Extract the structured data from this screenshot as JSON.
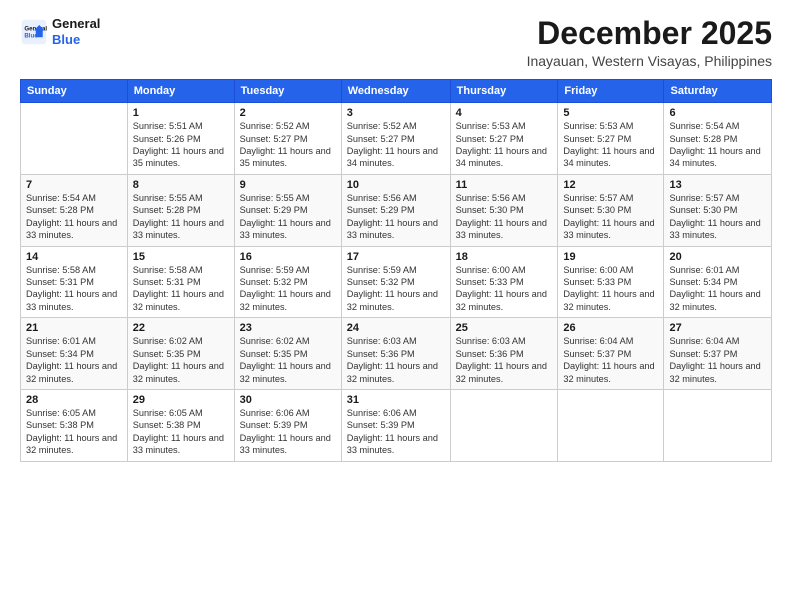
{
  "logo": {
    "line1": "General",
    "line2": "Blue"
  },
  "header": {
    "title": "December 2025",
    "subtitle": "Inayauan, Western Visayas, Philippines"
  },
  "weekdays": [
    "Sunday",
    "Monday",
    "Tuesday",
    "Wednesday",
    "Thursday",
    "Friday",
    "Saturday"
  ],
  "weeks": [
    [
      {
        "day": "",
        "sunrise": "",
        "sunset": "",
        "daylight": ""
      },
      {
        "day": "1",
        "sunrise": "Sunrise: 5:51 AM",
        "sunset": "Sunset: 5:26 PM",
        "daylight": "Daylight: 11 hours and 35 minutes."
      },
      {
        "day": "2",
        "sunrise": "Sunrise: 5:52 AM",
        "sunset": "Sunset: 5:27 PM",
        "daylight": "Daylight: 11 hours and 35 minutes."
      },
      {
        "day": "3",
        "sunrise": "Sunrise: 5:52 AM",
        "sunset": "Sunset: 5:27 PM",
        "daylight": "Daylight: 11 hours and 34 minutes."
      },
      {
        "day": "4",
        "sunrise": "Sunrise: 5:53 AM",
        "sunset": "Sunset: 5:27 PM",
        "daylight": "Daylight: 11 hours and 34 minutes."
      },
      {
        "day": "5",
        "sunrise": "Sunrise: 5:53 AM",
        "sunset": "Sunset: 5:27 PM",
        "daylight": "Daylight: 11 hours and 34 minutes."
      },
      {
        "day": "6",
        "sunrise": "Sunrise: 5:54 AM",
        "sunset": "Sunset: 5:28 PM",
        "daylight": "Daylight: 11 hours and 34 minutes."
      }
    ],
    [
      {
        "day": "7",
        "sunrise": "Sunrise: 5:54 AM",
        "sunset": "Sunset: 5:28 PM",
        "daylight": "Daylight: 11 hours and 33 minutes."
      },
      {
        "day": "8",
        "sunrise": "Sunrise: 5:55 AM",
        "sunset": "Sunset: 5:28 PM",
        "daylight": "Daylight: 11 hours and 33 minutes."
      },
      {
        "day": "9",
        "sunrise": "Sunrise: 5:55 AM",
        "sunset": "Sunset: 5:29 PM",
        "daylight": "Daylight: 11 hours and 33 minutes."
      },
      {
        "day": "10",
        "sunrise": "Sunrise: 5:56 AM",
        "sunset": "Sunset: 5:29 PM",
        "daylight": "Daylight: 11 hours and 33 minutes."
      },
      {
        "day": "11",
        "sunrise": "Sunrise: 5:56 AM",
        "sunset": "Sunset: 5:30 PM",
        "daylight": "Daylight: 11 hours and 33 minutes."
      },
      {
        "day": "12",
        "sunrise": "Sunrise: 5:57 AM",
        "sunset": "Sunset: 5:30 PM",
        "daylight": "Daylight: 11 hours and 33 minutes."
      },
      {
        "day": "13",
        "sunrise": "Sunrise: 5:57 AM",
        "sunset": "Sunset: 5:30 PM",
        "daylight": "Daylight: 11 hours and 33 minutes."
      }
    ],
    [
      {
        "day": "14",
        "sunrise": "Sunrise: 5:58 AM",
        "sunset": "Sunset: 5:31 PM",
        "daylight": "Daylight: 11 hours and 33 minutes."
      },
      {
        "day": "15",
        "sunrise": "Sunrise: 5:58 AM",
        "sunset": "Sunset: 5:31 PM",
        "daylight": "Daylight: 11 hours and 32 minutes."
      },
      {
        "day": "16",
        "sunrise": "Sunrise: 5:59 AM",
        "sunset": "Sunset: 5:32 PM",
        "daylight": "Daylight: 11 hours and 32 minutes."
      },
      {
        "day": "17",
        "sunrise": "Sunrise: 5:59 AM",
        "sunset": "Sunset: 5:32 PM",
        "daylight": "Daylight: 11 hours and 32 minutes."
      },
      {
        "day": "18",
        "sunrise": "Sunrise: 6:00 AM",
        "sunset": "Sunset: 5:33 PM",
        "daylight": "Daylight: 11 hours and 32 minutes."
      },
      {
        "day": "19",
        "sunrise": "Sunrise: 6:00 AM",
        "sunset": "Sunset: 5:33 PM",
        "daylight": "Daylight: 11 hours and 32 minutes."
      },
      {
        "day": "20",
        "sunrise": "Sunrise: 6:01 AM",
        "sunset": "Sunset: 5:34 PM",
        "daylight": "Daylight: 11 hours and 32 minutes."
      }
    ],
    [
      {
        "day": "21",
        "sunrise": "Sunrise: 6:01 AM",
        "sunset": "Sunset: 5:34 PM",
        "daylight": "Daylight: 11 hours and 32 minutes."
      },
      {
        "day": "22",
        "sunrise": "Sunrise: 6:02 AM",
        "sunset": "Sunset: 5:35 PM",
        "daylight": "Daylight: 11 hours and 32 minutes."
      },
      {
        "day": "23",
        "sunrise": "Sunrise: 6:02 AM",
        "sunset": "Sunset: 5:35 PM",
        "daylight": "Daylight: 11 hours and 32 minutes."
      },
      {
        "day": "24",
        "sunrise": "Sunrise: 6:03 AM",
        "sunset": "Sunset: 5:36 PM",
        "daylight": "Daylight: 11 hours and 32 minutes."
      },
      {
        "day": "25",
        "sunrise": "Sunrise: 6:03 AM",
        "sunset": "Sunset: 5:36 PM",
        "daylight": "Daylight: 11 hours and 32 minutes."
      },
      {
        "day": "26",
        "sunrise": "Sunrise: 6:04 AM",
        "sunset": "Sunset: 5:37 PM",
        "daylight": "Daylight: 11 hours and 32 minutes."
      },
      {
        "day": "27",
        "sunrise": "Sunrise: 6:04 AM",
        "sunset": "Sunset: 5:37 PM",
        "daylight": "Daylight: 11 hours and 32 minutes."
      }
    ],
    [
      {
        "day": "28",
        "sunrise": "Sunrise: 6:05 AM",
        "sunset": "Sunset: 5:38 PM",
        "daylight": "Daylight: 11 hours and 32 minutes."
      },
      {
        "day": "29",
        "sunrise": "Sunrise: 6:05 AM",
        "sunset": "Sunset: 5:38 PM",
        "daylight": "Daylight: 11 hours and 33 minutes."
      },
      {
        "day": "30",
        "sunrise": "Sunrise: 6:06 AM",
        "sunset": "Sunset: 5:39 PM",
        "daylight": "Daylight: 11 hours and 33 minutes."
      },
      {
        "day": "31",
        "sunrise": "Sunrise: 6:06 AM",
        "sunset": "Sunset: 5:39 PM",
        "daylight": "Daylight: 11 hours and 33 minutes."
      },
      {
        "day": "",
        "sunrise": "",
        "sunset": "",
        "daylight": ""
      },
      {
        "day": "",
        "sunrise": "",
        "sunset": "",
        "daylight": ""
      },
      {
        "day": "",
        "sunrise": "",
        "sunset": "",
        "daylight": ""
      }
    ]
  ]
}
